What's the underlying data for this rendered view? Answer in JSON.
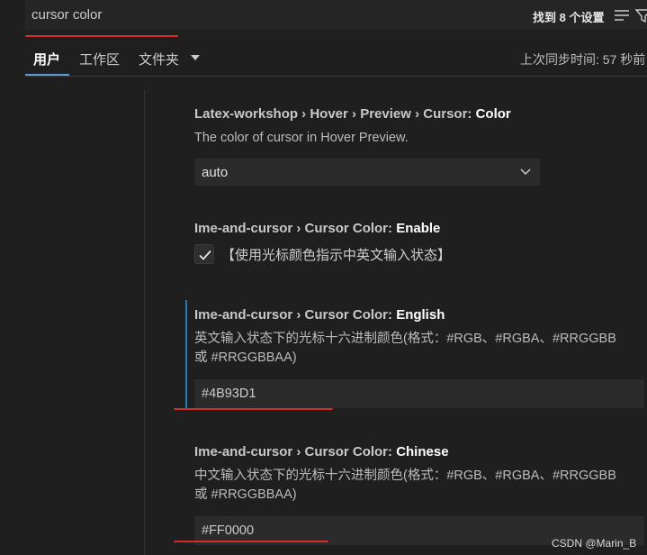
{
  "search": {
    "value": "cursor color",
    "found_count": "找到 8 个设置"
  },
  "tabs": [
    {
      "label": "用户",
      "active": true
    },
    {
      "label": "工作区",
      "active": false
    },
    {
      "label": "文件夹",
      "active": false
    }
  ],
  "sync_status": "上次同步时间: 57 秒前",
  "settings": [
    {
      "crumbs": "Latex-workshop › Hover › Preview › Cursor: ",
      "key": "Color",
      "description": "The color of cursor in Hover Preview.",
      "control": "select",
      "value": "auto"
    },
    {
      "crumbs": "Ime-and-cursor › Cursor Color: ",
      "key": "Enable",
      "control": "checkbox",
      "checked": true,
      "label": "【使用光标颜色指示中英文输入状态】"
    },
    {
      "crumbs": "Ime-and-cursor › Cursor Color: ",
      "key": "English",
      "description_line1": "英文输入状态下的光标十六进制颜色(格式：#RGB、#RGBA、#RRGGBB",
      "description_line2": "或 #RRGGBBAA)",
      "control": "text",
      "value": "#4B93D1"
    },
    {
      "crumbs": "Ime-and-cursor › Cursor Color: ",
      "key": "Chinese",
      "description_line1": "中文输入状态下的光标十六进制颜色(格式：#RGB、#RGBA、#RRGGBB",
      "description_line2": "或 #RRGGBBAA)",
      "control": "text",
      "value": "#FF0000"
    }
  ],
  "watermark": "CSDN @Marin_B",
  "colors": {
    "background": "#1f1f1f",
    "annotation_red": "#d42b2b",
    "modified_bar": "#1e7fb8",
    "accent_tab": "#5a9bd5"
  }
}
